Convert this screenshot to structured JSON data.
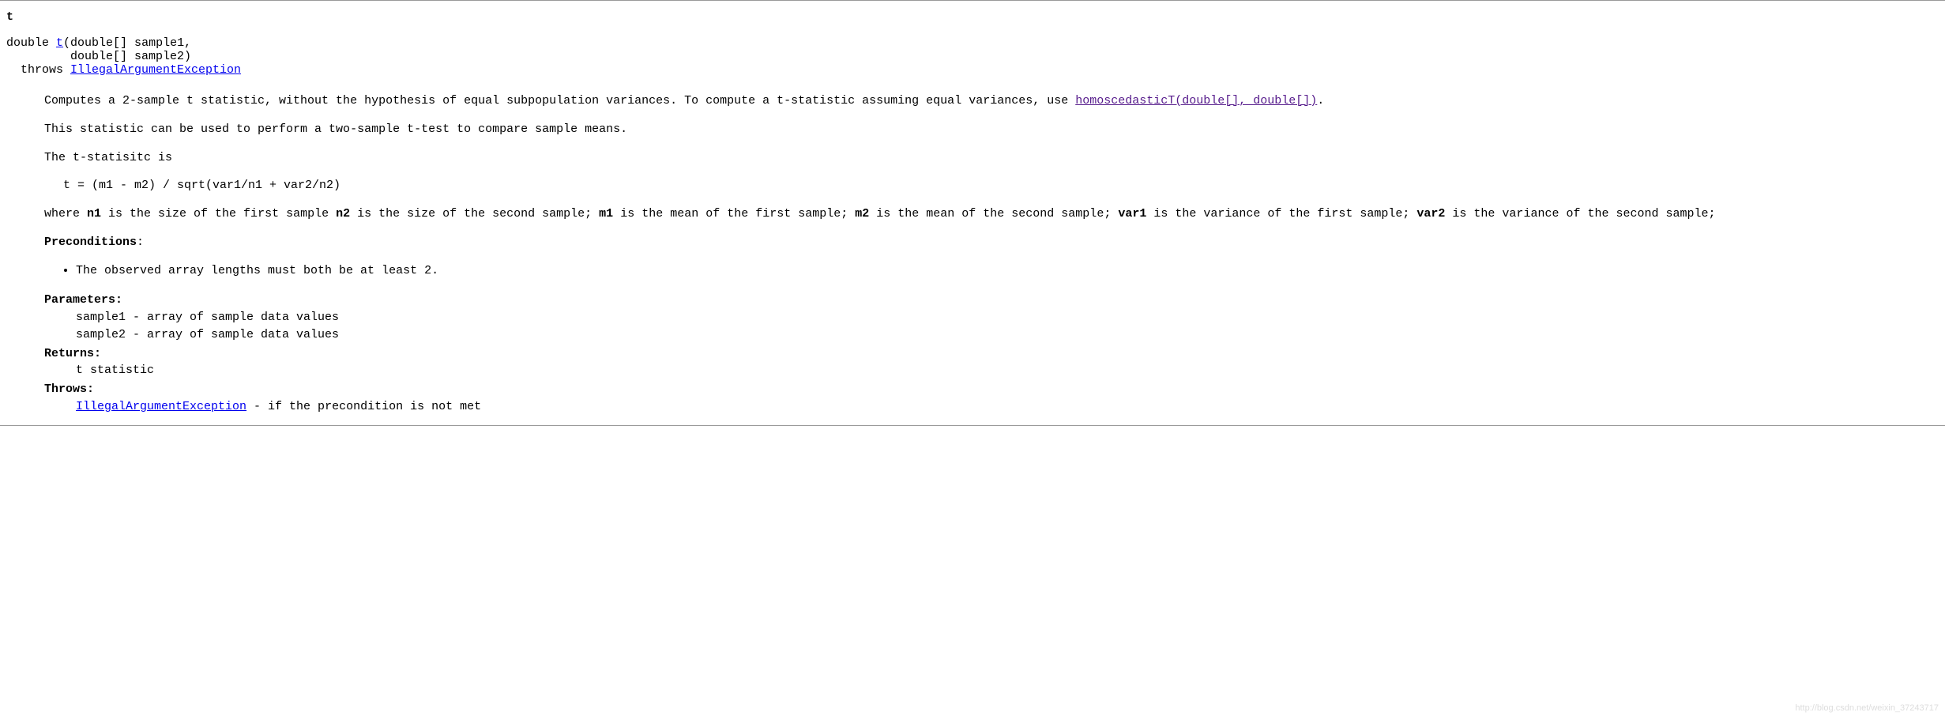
{
  "method": {
    "name": "t",
    "signature_return": "double",
    "signature_link": "t",
    "signature_line1_rest": "(double[] sample1,",
    "signature_line2": "         double[] sample2)",
    "signature_line3_prefix": "  throws ",
    "signature_throws_link": "IllegalArgumentException"
  },
  "desc": {
    "p1_part1": "Computes a 2-sample t statistic, without the hypothesis of equal subpopulation variances. To compute a t-statistic assuming equal variances, use ",
    "p1_link": "homoscedasticT(double[], double[])",
    "p1_part2": ".",
    "p2": "This statistic can be used to perform a two-sample t-test to compare sample means.",
    "p3": "The t-statisitc is",
    "formula": "t = (m1 - m2) / sqrt(var1/n1 + var2/n2)",
    "where_1": "where ",
    "n1": "n1",
    "where_2": " is the size of the first sample ",
    "n2": "n2",
    "where_3": " is the size of the second sample; ",
    "m1": "m1",
    "where_4": " is the mean of the first sample; ",
    "m2": "m2",
    "where_5": " is the mean of the second sample; ",
    "var1": "var1",
    "where_6": " is the variance of the first sample; ",
    "var2": "var2",
    "where_7": " is the variance of the second sample;",
    "precond_label": "Preconditions",
    "precond_colon": ":",
    "precond_item": "The observed array lengths must both be at least 2."
  },
  "tags": {
    "params_label": "Parameters:",
    "param1": "sample1 - array of sample data values",
    "param2": "sample2 - array of sample data values",
    "returns_label": "Returns:",
    "returns_val": "t statistic",
    "throws_label": "Throws:",
    "throws_link": "IllegalArgumentException",
    "throws_rest": " - if the precondition is not met"
  },
  "watermark": "http://blog.csdn.net/weixin_37243717"
}
